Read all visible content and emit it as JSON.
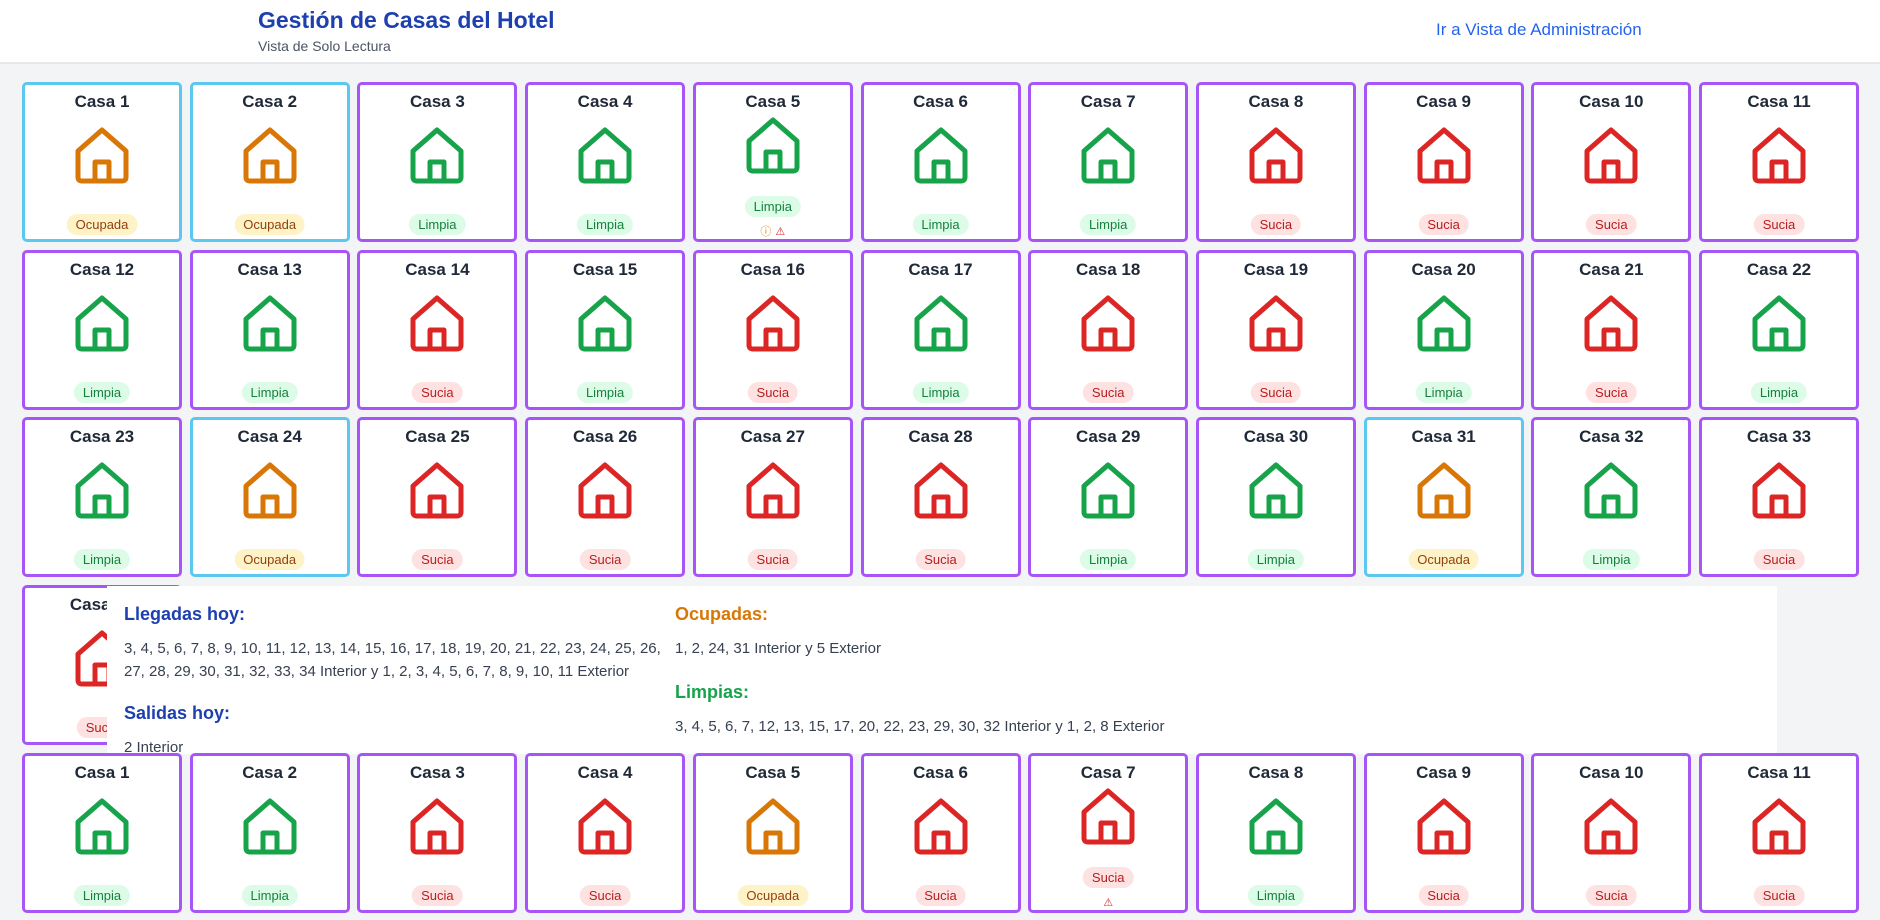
{
  "header": {
    "title": "Gestión de Casas del Hotel",
    "subtitle": "Vista de Solo Lectura",
    "admin_link": "Ir a Vista de Administración"
  },
  "colors": {
    "Limpia": "#16a34a",
    "Sucia": "#dc2626",
    "Ocupada": "#d97706",
    "card_border": "#a855f7",
    "card_border_occupied": "#5ac8ef"
  },
  "summary": {
    "arrivals_heading": "Llegadas hoy:",
    "arrivals_text": "3, 4, 5, 6, 7, 8, 9, 10, 11, 12, 13, 14, 15, 16, 17, 18, 19, 20, 21, 22, 23, 24, 25, 26, 27, 28, 29, 30, 31, 32, 33, 34 Interior y 1, 2, 3, 4, 5, 6, 7, 8, 9, 10, 11 Exterior",
    "departures_heading": "Salidas hoy:",
    "departures_text": "2 Interior",
    "occupied_heading": "Ocupadas:",
    "occupied_text": "1, 2, 24, 31 Interior y 5 Exterior",
    "clean_heading": "Limpias:",
    "clean_text": "3, 4, 5, 6, 7, 12, 13, 15, 17, 20, 22, 23, 29, 30, 32 Interior y 1, 2, 8 Exterior"
  },
  "interior_houses": [
    {
      "name": "Casa 1",
      "status": "Ocupada"
    },
    {
      "name": "Casa 2",
      "status": "Ocupada"
    },
    {
      "name": "Casa 3",
      "status": "Limpia"
    },
    {
      "name": "Casa 4",
      "status": "Limpia"
    },
    {
      "name": "Casa 5",
      "status": "Limpia",
      "alerts": [
        "info",
        "warning"
      ]
    },
    {
      "name": "Casa 6",
      "status": "Limpia"
    },
    {
      "name": "Casa 7",
      "status": "Limpia"
    },
    {
      "name": "Casa 8",
      "status": "Sucia"
    },
    {
      "name": "Casa 9",
      "status": "Sucia"
    },
    {
      "name": "Casa 10",
      "status": "Sucia"
    },
    {
      "name": "Casa 11",
      "status": "Sucia"
    },
    {
      "name": "Casa 12",
      "status": "Limpia"
    },
    {
      "name": "Casa 13",
      "status": "Limpia"
    },
    {
      "name": "Casa 14",
      "status": "Sucia"
    },
    {
      "name": "Casa 15",
      "status": "Limpia"
    },
    {
      "name": "Casa 16",
      "status": "Sucia"
    },
    {
      "name": "Casa 17",
      "status": "Limpia"
    },
    {
      "name": "Casa 18",
      "status": "Sucia"
    },
    {
      "name": "Casa 19",
      "status": "Sucia"
    },
    {
      "name": "Casa 20",
      "status": "Limpia"
    },
    {
      "name": "Casa 21",
      "status": "Sucia"
    },
    {
      "name": "Casa 22",
      "status": "Limpia"
    },
    {
      "name": "Casa 23",
      "status": "Limpia"
    },
    {
      "name": "Casa 24",
      "status": "Ocupada"
    },
    {
      "name": "Casa 25",
      "status": "Sucia"
    },
    {
      "name": "Casa 26",
      "status": "Sucia"
    },
    {
      "name": "Casa 27",
      "status": "Sucia"
    },
    {
      "name": "Casa 28",
      "status": "Sucia"
    },
    {
      "name": "Casa 29",
      "status": "Limpia"
    },
    {
      "name": "Casa 30",
      "status": "Limpia"
    },
    {
      "name": "Casa 31",
      "status": "Ocupada"
    },
    {
      "name": "Casa 32",
      "status": "Limpia"
    },
    {
      "name": "Casa 33",
      "status": "Sucia"
    },
    {
      "name": "Casa 34",
      "status": "Sucia"
    }
  ],
  "exterior_houses": [
    {
      "name": "Casa 1",
      "status": "Limpia"
    },
    {
      "name": "Casa 2",
      "status": "Limpia"
    },
    {
      "name": "Casa 3",
      "status": "Sucia"
    },
    {
      "name": "Casa 4",
      "status": "Sucia"
    },
    {
      "name": "Casa 5",
      "status": "Ocupada"
    },
    {
      "name": "Casa 6",
      "status": "Sucia"
    },
    {
      "name": "Casa 7",
      "status": "Sucia",
      "alerts": [
        "warning"
      ]
    },
    {
      "name": "Casa 8",
      "status": "Limpia"
    },
    {
      "name": "Casa 9",
      "status": "Sucia"
    },
    {
      "name": "Casa 10",
      "status": "Sucia"
    },
    {
      "name": "Casa 11",
      "status": "Sucia"
    }
  ]
}
